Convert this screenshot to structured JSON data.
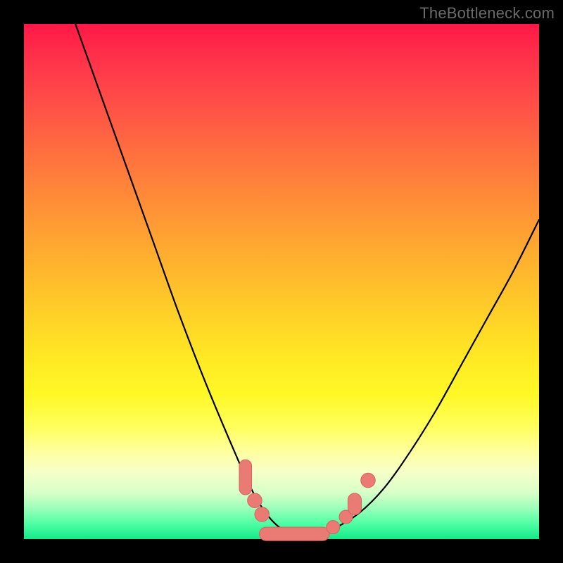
{
  "watermark": "TheBottleneck.com",
  "colors": {
    "background": "#000000",
    "curve": "#000000",
    "marker_fill": "#e97a74",
    "marker_stroke": "#d9635e"
  },
  "chart_data": {
    "type": "line",
    "title": "",
    "xlabel": "",
    "ylabel": "",
    "xlim": [
      0,
      100
    ],
    "ylim": [
      0,
      100
    ],
    "grid": false,
    "series": [
      {
        "name": "bottleneck-curve",
        "x": [
          10,
          15,
          20,
          25,
          30,
          35,
          40,
          44,
          47,
          50,
          53,
          56,
          60,
          65,
          70,
          75,
          80,
          85,
          90,
          95,
          100
        ],
        "values": [
          100,
          86,
          72,
          58,
          44,
          31,
          19,
          10,
          5,
          2,
          1,
          1,
          2,
          5,
          10,
          17,
          25,
          34,
          43,
          52,
          62
        ]
      }
    ],
    "markers": [
      {
        "shape": "pill",
        "x": 43.0,
        "y": 12.0,
        "rx": 1.2,
        "ry": 3.4,
        "label": "left-upper-pill"
      },
      {
        "shape": "circle",
        "x": 44.8,
        "y": 7.5,
        "r": 1.4,
        "label": "left-mid-dot"
      },
      {
        "shape": "circle",
        "x": 46.2,
        "y": 4.8,
        "r": 1.4,
        "label": "left-low-dot"
      },
      {
        "shape": "pill",
        "x": 52.5,
        "y": 1.0,
        "rx": 6.8,
        "ry": 1.3,
        "label": "bottom-bar"
      },
      {
        "shape": "circle",
        "x": 60.0,
        "y": 2.3,
        "r": 1.3,
        "label": "right-low-dot"
      },
      {
        "shape": "circle",
        "x": 62.5,
        "y": 4.3,
        "r": 1.3,
        "label": "right-mid-dot"
      },
      {
        "shape": "pill",
        "x": 64.2,
        "y": 6.8,
        "rx": 1.3,
        "ry": 2.1,
        "label": "right-pill"
      },
      {
        "shape": "circle",
        "x": 66.8,
        "y": 11.4,
        "r": 1.4,
        "label": "right-upper-dot"
      }
    ]
  }
}
